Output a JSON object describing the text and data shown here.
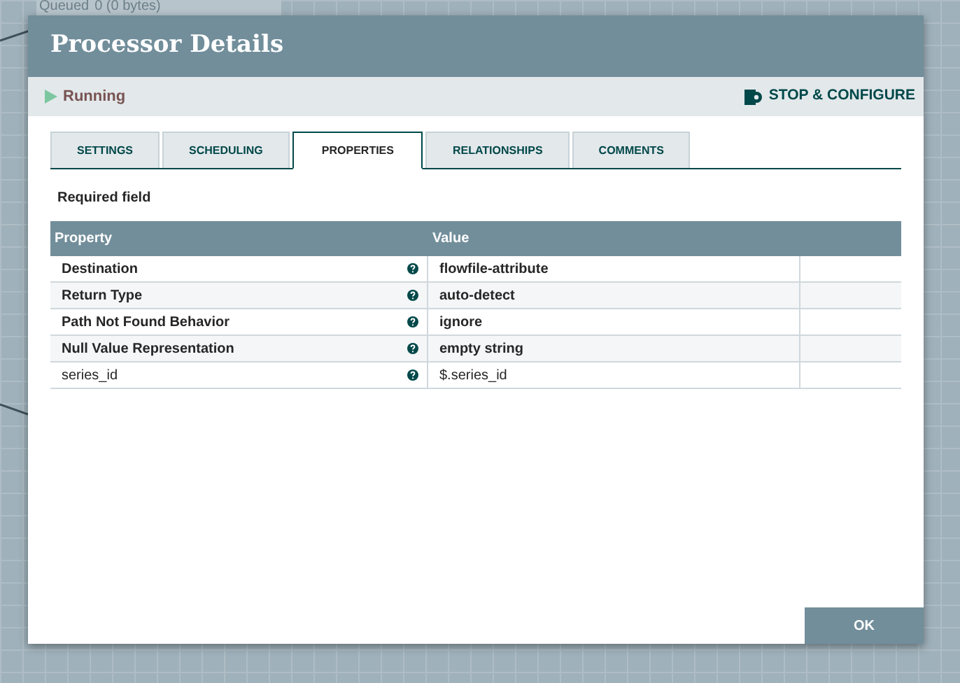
{
  "canvas": {
    "queued_label": "Queued",
    "queued_value": "0 (0 bytes)"
  },
  "window": {
    "title": "Processor Details"
  },
  "status": {
    "state": "Running",
    "action": "STOP & CONFIGURE"
  },
  "tabs": [
    {
      "label": "SETTINGS",
      "selected": false
    },
    {
      "label": "SCHEDULING",
      "selected": false
    },
    {
      "label": "PROPERTIES",
      "selected": true
    },
    {
      "label": "RELATIONSHIPS",
      "selected": false
    },
    {
      "label": "COMMENTS",
      "selected": false
    }
  ],
  "required_note": "Required field",
  "table": {
    "columns": [
      "Property",
      "Value"
    ],
    "rows": [
      {
        "property": "Destination",
        "value": "flowfile-attribute",
        "required": true
      },
      {
        "property": "Return Type",
        "value": "auto-detect",
        "required": true
      },
      {
        "property": "Path Not Found Behavior",
        "value": "ignore",
        "required": true
      },
      {
        "property": "Null Value Representation",
        "value": "empty string",
        "required": true
      },
      {
        "property": "series_id",
        "value": "$.series_id",
        "required": false
      }
    ]
  },
  "buttons": [
    "OK"
  ]
}
